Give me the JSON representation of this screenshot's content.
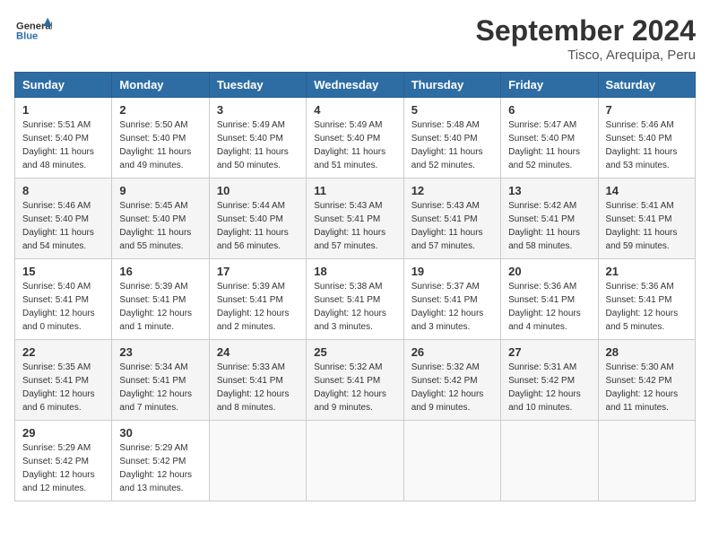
{
  "header": {
    "logo_general": "General",
    "logo_blue": "Blue",
    "month_year": "September 2024",
    "location": "Tisco, Arequipa, Peru"
  },
  "days_of_week": [
    "Sunday",
    "Monday",
    "Tuesday",
    "Wednesday",
    "Thursday",
    "Friday",
    "Saturday"
  ],
  "weeks": [
    [
      {
        "day": "1",
        "sunrise": "5:51 AM",
        "sunset": "5:40 PM",
        "daylight": "11 hours and 48 minutes."
      },
      {
        "day": "2",
        "sunrise": "5:50 AM",
        "sunset": "5:40 PM",
        "daylight": "11 hours and 49 minutes."
      },
      {
        "day": "3",
        "sunrise": "5:49 AM",
        "sunset": "5:40 PM",
        "daylight": "11 hours and 50 minutes."
      },
      {
        "day": "4",
        "sunrise": "5:49 AM",
        "sunset": "5:40 PM",
        "daylight": "11 hours and 51 minutes."
      },
      {
        "day": "5",
        "sunrise": "5:48 AM",
        "sunset": "5:40 PM",
        "daylight": "11 hours and 52 minutes."
      },
      {
        "day": "6",
        "sunrise": "5:47 AM",
        "sunset": "5:40 PM",
        "daylight": "11 hours and 52 minutes."
      },
      {
        "day": "7",
        "sunrise": "5:46 AM",
        "sunset": "5:40 PM",
        "daylight": "11 hours and 53 minutes."
      }
    ],
    [
      {
        "day": "8",
        "sunrise": "5:46 AM",
        "sunset": "5:40 PM",
        "daylight": "11 hours and 54 minutes."
      },
      {
        "day": "9",
        "sunrise": "5:45 AM",
        "sunset": "5:40 PM",
        "daylight": "11 hours and 55 minutes."
      },
      {
        "day": "10",
        "sunrise": "5:44 AM",
        "sunset": "5:40 PM",
        "daylight": "11 hours and 56 minutes."
      },
      {
        "day": "11",
        "sunrise": "5:43 AM",
        "sunset": "5:41 PM",
        "daylight": "11 hours and 57 minutes."
      },
      {
        "day": "12",
        "sunrise": "5:43 AM",
        "sunset": "5:41 PM",
        "daylight": "11 hours and 57 minutes."
      },
      {
        "day": "13",
        "sunrise": "5:42 AM",
        "sunset": "5:41 PM",
        "daylight": "11 hours and 58 minutes."
      },
      {
        "day": "14",
        "sunrise": "5:41 AM",
        "sunset": "5:41 PM",
        "daylight": "11 hours and 59 minutes."
      }
    ],
    [
      {
        "day": "15",
        "sunrise": "5:40 AM",
        "sunset": "5:41 PM",
        "daylight": "12 hours and 0 minutes."
      },
      {
        "day": "16",
        "sunrise": "5:39 AM",
        "sunset": "5:41 PM",
        "daylight": "12 hours and 1 minute."
      },
      {
        "day": "17",
        "sunrise": "5:39 AM",
        "sunset": "5:41 PM",
        "daylight": "12 hours and 2 minutes."
      },
      {
        "day": "18",
        "sunrise": "5:38 AM",
        "sunset": "5:41 PM",
        "daylight": "12 hours and 3 minutes."
      },
      {
        "day": "19",
        "sunrise": "5:37 AM",
        "sunset": "5:41 PM",
        "daylight": "12 hours and 3 minutes."
      },
      {
        "day": "20",
        "sunrise": "5:36 AM",
        "sunset": "5:41 PM",
        "daylight": "12 hours and 4 minutes."
      },
      {
        "day": "21",
        "sunrise": "5:36 AM",
        "sunset": "5:41 PM",
        "daylight": "12 hours and 5 minutes."
      }
    ],
    [
      {
        "day": "22",
        "sunrise": "5:35 AM",
        "sunset": "5:41 PM",
        "daylight": "12 hours and 6 minutes."
      },
      {
        "day": "23",
        "sunrise": "5:34 AM",
        "sunset": "5:41 PM",
        "daylight": "12 hours and 7 minutes."
      },
      {
        "day": "24",
        "sunrise": "5:33 AM",
        "sunset": "5:41 PM",
        "daylight": "12 hours and 8 minutes."
      },
      {
        "day": "25",
        "sunrise": "5:32 AM",
        "sunset": "5:41 PM",
        "daylight": "12 hours and 9 minutes."
      },
      {
        "day": "26",
        "sunrise": "5:32 AM",
        "sunset": "5:42 PM",
        "daylight": "12 hours and 9 minutes."
      },
      {
        "day": "27",
        "sunrise": "5:31 AM",
        "sunset": "5:42 PM",
        "daylight": "12 hours and 10 minutes."
      },
      {
        "day": "28",
        "sunrise": "5:30 AM",
        "sunset": "5:42 PM",
        "daylight": "12 hours and 11 minutes."
      }
    ],
    [
      {
        "day": "29",
        "sunrise": "5:29 AM",
        "sunset": "5:42 PM",
        "daylight": "12 hours and 12 minutes."
      },
      {
        "day": "30",
        "sunrise": "5:29 AM",
        "sunset": "5:42 PM",
        "daylight": "12 hours and 13 minutes."
      },
      null,
      null,
      null,
      null,
      null
    ]
  ]
}
